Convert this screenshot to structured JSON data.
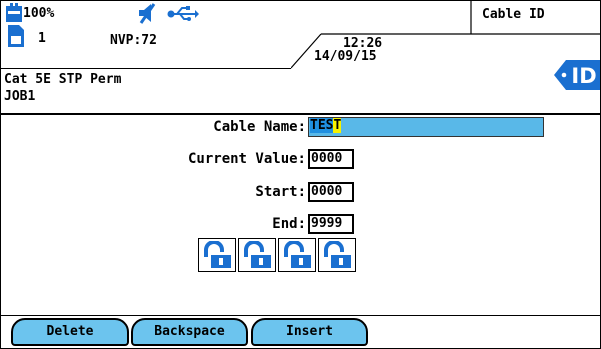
{
  "status": {
    "battery": "100%",
    "memory_count": "1",
    "nvp": "NVP:72",
    "time": "12:26",
    "date": "14/09/15",
    "tab_title": "Cable ID"
  },
  "header": {
    "cable_type": "Cat 5E STP Perm",
    "job": "JOB1"
  },
  "form": {
    "cable_name_label": "Cable Name:",
    "cable_name_value_selected": "TES",
    "cable_name_value_cursor": "T",
    "current_value_label": "Current Value:",
    "current_value": "0000",
    "start_label": "Start:",
    "start_value": "0000",
    "end_label": "End:",
    "end_value": "9999"
  },
  "badge": {
    "text": "ID"
  },
  "softkeys": {
    "delete": "Delete",
    "backspace": "Backspace",
    "insert": "Insert"
  },
  "colors": {
    "softkey_bg": "#6cc4ee",
    "name_field_bg": "#59b8e8",
    "lock_blue": "#1a6fd0",
    "badge_blue": "#1a6fd0"
  },
  "icons": [
    "battery-icon",
    "speaker-muted-icon",
    "usb-icon",
    "sd-card-icon",
    "unlock-icon",
    "id-tag-icon"
  ]
}
